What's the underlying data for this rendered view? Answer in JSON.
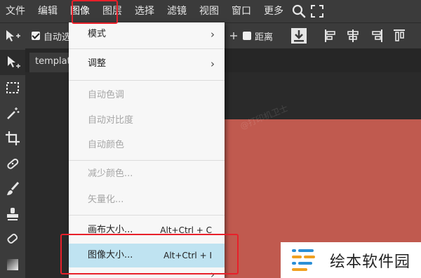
{
  "menubar": {
    "items": [
      "文件",
      "编辑",
      "图像",
      "图层",
      "选择",
      "滤镜",
      "视图",
      "窗口",
      "更多"
    ],
    "active_index": 2
  },
  "options_bar": {
    "auto_select_label": "自动选",
    "auto_select_checked": true,
    "distance_label": "距离",
    "distance_checked": false
  },
  "doc_tab": {
    "name": "template"
  },
  "image_menu": {
    "items": [
      {
        "label": "模式",
        "submenu": true,
        "enabled": true
      },
      {
        "label": "调整",
        "submenu": true,
        "enabled": true
      },
      {
        "label": "自动色调",
        "enabled": false
      },
      {
        "label": "自动对比度",
        "enabled": false
      },
      {
        "label": "自动颜色",
        "enabled": false
      },
      {
        "label": "减少颜色...",
        "enabled": false
      },
      {
        "label": "矢量化...",
        "enabled": false
      },
      {
        "label": "画布大小...",
        "shortcut": "Alt+Ctrl + C",
        "enabled": true
      },
      {
        "label": "图像大小...",
        "shortcut": "Alt+Ctrl + I",
        "enabled": true,
        "highlighted": true
      }
    ]
  },
  "watermark_text": "@打印机卫士",
  "brand_badge": {
    "name": "绘本软件园"
  },
  "colors": {
    "canvas": "#c05a4f",
    "highlight": "#bfe3f1",
    "annotation_box": "#e8202a"
  }
}
